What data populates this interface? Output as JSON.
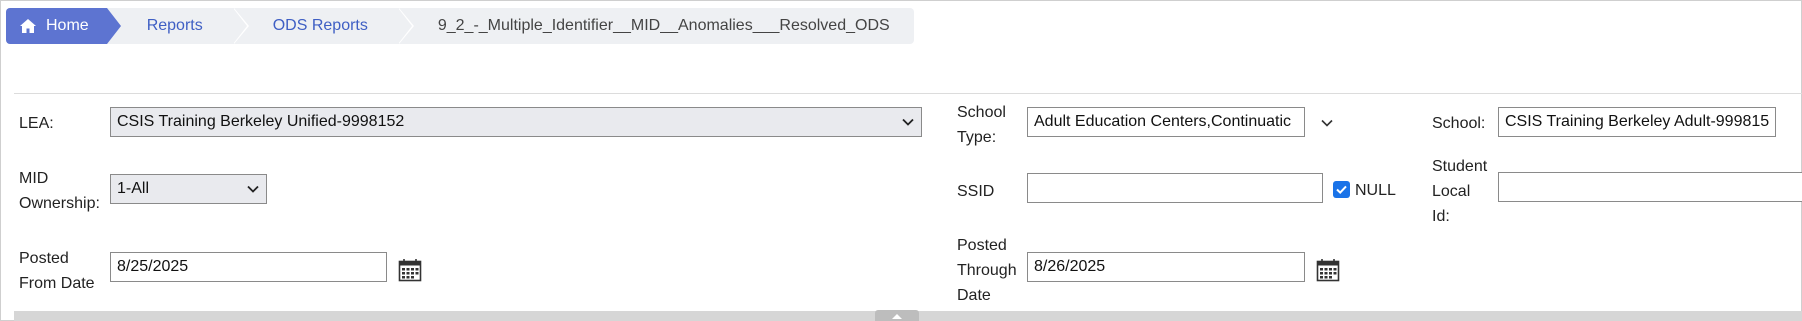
{
  "breadcrumb": {
    "home": "Home",
    "reports": "Reports",
    "ods_reports": "ODS Reports",
    "current": "9_2_-_Multiple_Identifier__MID__Anomalies___Resolved_ODS"
  },
  "form": {
    "lea": {
      "label": "LEA:",
      "value": "CSIS Training Berkeley Unified-9998152"
    },
    "school_type": {
      "label_line1": "School",
      "label_line2": "Type:",
      "value": "Adult Education Centers,Continuatic"
    },
    "school": {
      "label": "School:",
      "value": "CSIS Training Berkeley Adult-999815"
    },
    "mid_ownership": {
      "label_line1": "MID",
      "label_line2": "Ownership:",
      "value": "1-All"
    },
    "ssid": {
      "label": "SSID",
      "value": "",
      "null_label": "NULL",
      "null_checked": true
    },
    "student_local_id": {
      "label_line1": "Student",
      "label_line2": "Local",
      "label_line3": "Id:",
      "value": ""
    },
    "posted_from": {
      "label_line1": "Posted",
      "label_line2": "From Date",
      "value": "8/25/2025"
    },
    "posted_through": {
      "label_line1": "Posted",
      "label_line2": "Through",
      "label_line3": "Date",
      "value": "8/26/2025"
    }
  },
  "icons": {
    "home": "home-icon",
    "calendar": "calendar-icon",
    "chevron": "chevron-down-icon",
    "collapse": "collapse-up-icon"
  },
  "colors": {
    "home_crumb_bg": "#5d74d1",
    "link": "#3f5fc4",
    "checkbox": "#1a73e8"
  }
}
